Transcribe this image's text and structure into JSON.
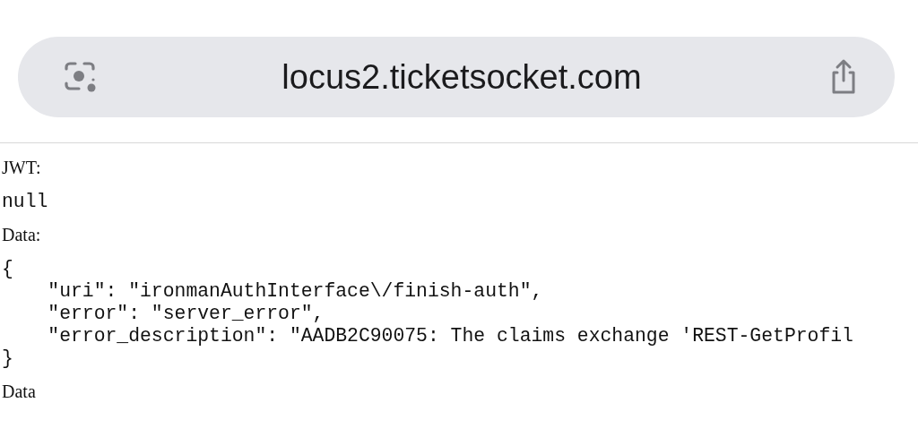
{
  "address_bar": {
    "url": "locus2.ticketsocket.com"
  },
  "content": [
    {
      "kind": "label",
      "text": "JWT:"
    },
    {
      "kind": "code",
      "lines": [
        "null"
      ]
    },
    {
      "kind": "label",
      "text": "Data:"
    },
    {
      "kind": "code",
      "lines": [
        "{",
        "    \"uri\": \"ironmanAuthInterface\\/finish-auth\",",
        "    \"error\": \"server_error\",",
        "    \"error_description\": \"AADB2C90075: The claims exchange 'REST-GetProfil",
        "}"
      ]
    },
    {
      "kind": "label",
      "text": "Data"
    }
  ]
}
